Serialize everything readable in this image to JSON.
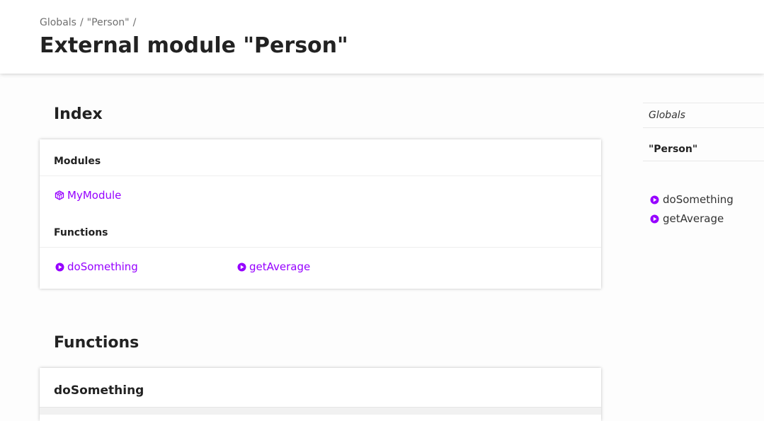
{
  "header": {
    "breadcrumb": [
      "Globals",
      "\"Person\""
    ],
    "breadcrumb_separator": "/",
    "title": "External module \"Person\""
  },
  "index": {
    "title": "Index",
    "modules_heading": "Modules",
    "modules": [
      {
        "label": "MyModule",
        "icon": "module-cube-icon"
      }
    ],
    "functions_heading": "Functions",
    "functions": [
      {
        "label": "doSomething",
        "icon": "function-bullet-icon"
      },
      {
        "label": "getAverage",
        "icon": "function-bullet-icon"
      }
    ]
  },
  "functions_section": {
    "title": "Functions",
    "first_item": "doSomething"
  },
  "sidebar": {
    "globals": "Globals",
    "current": "\"Person\"",
    "links": [
      {
        "label": "doSomething",
        "icon": "function-bullet-icon"
      },
      {
        "label": "getAverage",
        "icon": "function-bullet-icon"
      }
    ]
  },
  "colors": {
    "accent": "#9600ff",
    "background": "#fdfdfd",
    "panel": "#ffffff",
    "text": "#222222"
  }
}
